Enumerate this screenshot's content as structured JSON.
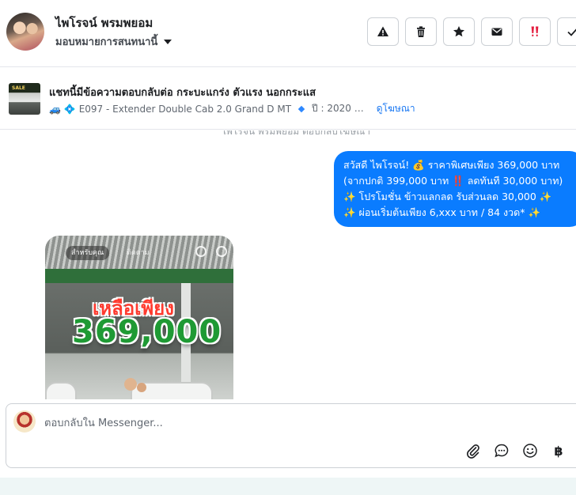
{
  "header": {
    "contact_name": "ไพโรจน์ พรมพยอม",
    "assign_label": "มอบหมายการสนทนานี้",
    "actions": [
      {
        "name": "report-spam",
        "icon": "warning-icon"
      },
      {
        "name": "delete",
        "icon": "trash-icon"
      },
      {
        "name": "star",
        "icon": "star-icon"
      },
      {
        "name": "mark-unread",
        "icon": "mail-icon"
      },
      {
        "name": "follow-up",
        "icon": "double-exclamation-icon"
      },
      {
        "name": "mark-done",
        "icon": "check-icon"
      }
    ]
  },
  "ad": {
    "title": "แชทนี้มีข้อความตอบกลับต่อ กระบะแกร่ง ตัวแรง นอกกระแส",
    "emojis": "🚙 💠",
    "model": "E097 - Extender Double Cab 2.0 Grand D MT",
    "year": "ปี : 2020 …",
    "link": "ดูโฆษณา"
  },
  "conversation": {
    "faded_note": "ไพโรจน์ พรมพยอม ตอบกลับโฆษณา",
    "outgoing_lines": [
      "สวัสดี ไพโรจน์! 💰 ราคาพิเศษเพียง 369,000 บาท",
      "(จากปกติ 399,000 บาท ‼️ ลดทันที 30,000 บาท)",
      "✨ โปรโมชั่น ข้าวแลกลด รับส่วนลด 30,000 ✨",
      "✨ ผ่อนเริ่มต้นเพียง 6,xxx บาท / 84 งวด* ✨"
    ],
    "image": {
      "tab_active": "สำหรับคุณ",
      "tab_other": "ติดตาม",
      "headline": "เหลือเพียง",
      "price": "369,000"
    }
  },
  "composer": {
    "placeholder": "ตอบกลับใน Messenger...",
    "tools": [
      "paperclip-icon",
      "chat-bubble-icon",
      "emoji-icon",
      "baht-icon"
    ],
    "baht_symbol": "฿"
  },
  "colors": {
    "accent": "#0a7cff",
    "link": "#1877f2",
    "follow_up": "#e41e3f"
  }
}
